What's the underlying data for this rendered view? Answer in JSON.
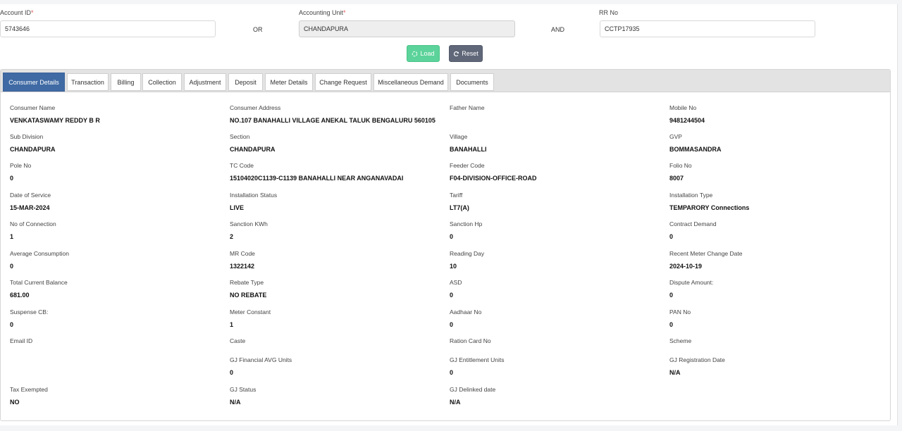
{
  "search": {
    "account_id": {
      "label": "Account ID",
      "required_mark": "*",
      "value": "5743646"
    },
    "or_label": "OR",
    "accounting_unit": {
      "label": "Accounting Unit",
      "required_mark": "*",
      "value": "CHANDAPURA"
    },
    "and_label": "AND",
    "rr_no": {
      "label": "RR No",
      "value": "CCTP17935"
    },
    "load_label": "Load",
    "reset_label": "Reset"
  },
  "colors": {
    "active_tab": "#3f6aa4",
    "load_button": "#5cd39a",
    "reset_button": "#5f6778"
  },
  "tabs": [
    {
      "label": "Consumer Details",
      "active": true
    },
    {
      "label": "Transaction"
    },
    {
      "label": "Billing"
    },
    {
      "label": "Collection"
    },
    {
      "label": "Adjustment"
    },
    {
      "label": "Deposit"
    },
    {
      "label": "Meter Details"
    },
    {
      "label": "Change Request"
    },
    {
      "label": "Miscellaneous Demand"
    },
    {
      "label": "Documents"
    }
  ],
  "details": [
    {
      "label": "Consumer Name",
      "value": "VENKATASWAMY REDDY B R"
    },
    {
      "label": "Consumer Address",
      "value": "NO.107 BANAHALLI VILLAGE ANEKAL TALUK BENGALURU 560105"
    },
    {
      "label": "Father Name",
      "value": ""
    },
    {
      "label": "Mobile No",
      "value": "9481244504"
    },
    {
      "label": "Sub Division",
      "value": "CHANDAPURA"
    },
    {
      "label": "Section",
      "value": "CHANDAPURA"
    },
    {
      "label": "Village",
      "value": "BANAHALLI"
    },
    {
      "label": "GVP",
      "value": "BOMMASANDRA"
    },
    {
      "label": "Pole No",
      "value": "0"
    },
    {
      "label": "TC Code",
      "value": "15104020C1139-C1139 BANAHALLI NEAR ANGANAVADAI"
    },
    {
      "label": "Feeder Code",
      "value": "F04-DIVISION-OFFICE-ROAD"
    },
    {
      "label": "Folio No",
      "value": "8007"
    },
    {
      "label": "Date of Service",
      "value": "15-MAR-2024"
    },
    {
      "label": "Installation Status",
      "value": "LIVE"
    },
    {
      "label": "Tariff",
      "value": "LT7(A)"
    },
    {
      "label": "Installation Type",
      "value": "TEMPARORY Connections"
    },
    {
      "label": "No of Connection",
      "value": "1"
    },
    {
      "label": "Sanction KWh",
      "value": "2"
    },
    {
      "label": "Sanction Hp",
      "value": "0"
    },
    {
      "label": "Contract Demand",
      "value": "0"
    },
    {
      "label": "Average Consumption",
      "value": "0"
    },
    {
      "label": "MR Code",
      "value": "1322142"
    },
    {
      "label": "Reading Day",
      "value": "10"
    },
    {
      "label": "Recent Meter Change Date",
      "value": "2024-10-19"
    },
    {
      "label": "Total Current Balance",
      "value": "681.00"
    },
    {
      "label": "Rebate Type",
      "value": "NO REBATE"
    },
    {
      "label": "ASD",
      "value": "0"
    },
    {
      "label": "Dispute Amount:",
      "value": "0"
    },
    {
      "label": "Suspense CB:",
      "value": "0"
    },
    {
      "label": "Meter Constant",
      "value": "1"
    },
    {
      "label": "Aadhaar No",
      "value": "0"
    },
    {
      "label": "PAN No",
      "value": "0"
    },
    {
      "label": "Email ID",
      "value": ""
    },
    {
      "label": "Caste",
      "value": ""
    },
    {
      "label": "Ration Card No",
      "value": ""
    },
    {
      "label": "Scheme",
      "value": ""
    },
    {
      "label": "GJ Financial AVG Units",
      "value": "0"
    },
    {
      "label": "GJ Entitlement Units",
      "value": "0"
    },
    {
      "label": "GJ Registration Date",
      "value": "N/A"
    },
    {
      "label": "Tax Exempted",
      "value": "NO"
    },
    {
      "label": "GJ Status",
      "value": "N/A"
    },
    {
      "label": "GJ Delinked date",
      "value": "N/A"
    }
  ]
}
